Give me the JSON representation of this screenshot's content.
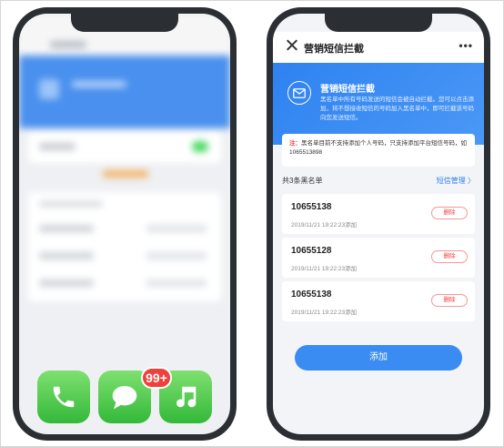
{
  "left_phone": {
    "badge": "99+",
    "dock": [
      {
        "icon": "phone-icon"
      },
      {
        "icon": "message-icon"
      },
      {
        "icon": "music-icon"
      }
    ]
  },
  "app": {
    "title": "营销短信拦截",
    "more": "•••",
    "hero": {
      "title": "营销短信拦截",
      "description": "黑名单中所有号码发送的短信会被自动拦截。您可以点击添加，将不想接收短信的号码加入黑名单中，即可拦截该号码向您发送短信。"
    },
    "notice": {
      "prefix": "注：",
      "text": "黑名单目前不支持添加个人号码，只支持添加平台短信号码，如1065513898"
    },
    "list": {
      "count_label": "共3条黑名单",
      "manage_label": "短信管理 〉",
      "items": [
        {
          "number": "10655138",
          "time": "2019/11/21 19:22:23添加",
          "delete": "删除"
        },
        {
          "number": "10655128",
          "time": "2019/11/21 19:22:23添加",
          "delete": "删除"
        },
        {
          "number": "10655138",
          "time": "2019/11/21 19:22:23添加",
          "delete": "删除"
        }
      ]
    },
    "add_button": "添加"
  }
}
